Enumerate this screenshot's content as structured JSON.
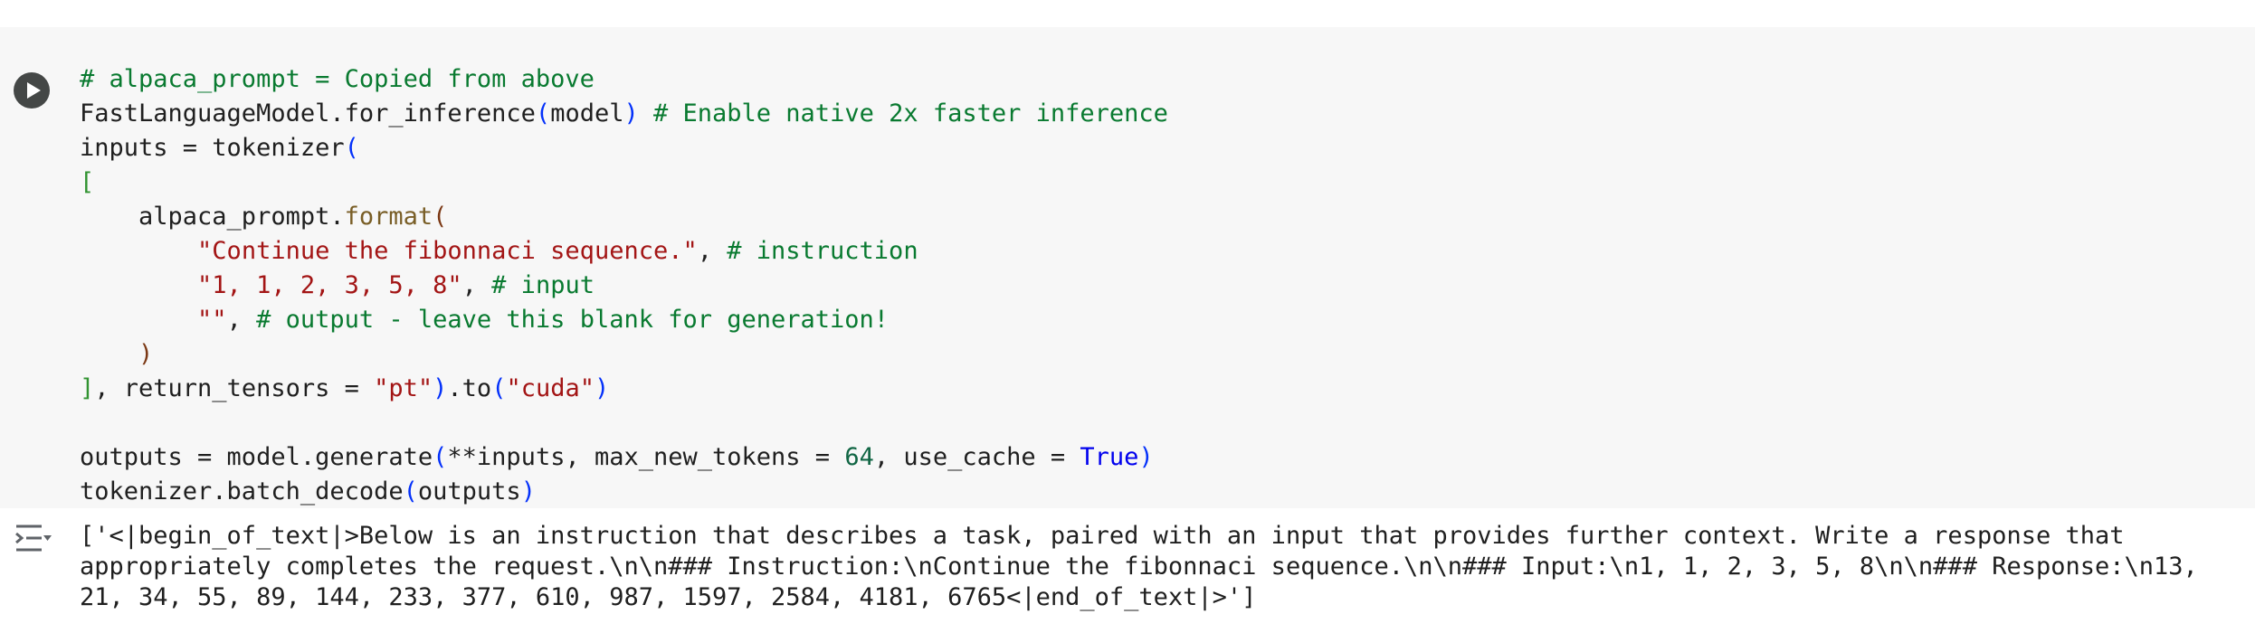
{
  "cell": {
    "run_button": "run-cell-button",
    "lines": [
      [
        {
          "t": "# alpaca_prompt = Copied from above",
          "c": "cmt"
        }
      ],
      [
        {
          "t": "FastLanguageModel.for_inference",
          "c": ""
        },
        {
          "t": "(",
          "c": "br"
        },
        {
          "t": "model",
          "c": ""
        },
        {
          "t": ")",
          "c": "br"
        },
        {
          "t": " ",
          "c": ""
        },
        {
          "t": "# Enable native 2x faster inference",
          "c": "cmt"
        }
      ],
      [
        {
          "t": "inputs = tokenizer",
          "c": ""
        },
        {
          "t": "(",
          "c": "br"
        }
      ],
      [
        {
          "t": "[",
          "c": "brg"
        }
      ],
      [
        {
          "t": "    alpaca_prompt.",
          "c": ""
        },
        {
          "t": "format",
          "c": "fn"
        },
        {
          "t": "(",
          "c": "brr"
        }
      ],
      [
        {
          "t": "        ",
          "c": ""
        },
        {
          "t": "\"Continue the fibonnaci sequence.\"",
          "c": "str"
        },
        {
          "t": ", ",
          "c": ""
        },
        {
          "t": "# instruction",
          "c": "cmt"
        }
      ],
      [
        {
          "t": "        ",
          "c": ""
        },
        {
          "t": "\"1, 1, 2, 3, 5, 8\"",
          "c": "str"
        },
        {
          "t": ", ",
          "c": ""
        },
        {
          "t": "# input",
          "c": "cmt"
        }
      ],
      [
        {
          "t": "        ",
          "c": ""
        },
        {
          "t": "\"\"",
          "c": "str"
        },
        {
          "t": ", ",
          "c": ""
        },
        {
          "t": "# output - leave this blank for generation!",
          "c": "cmt"
        }
      ],
      [
        {
          "t": "    ",
          "c": ""
        },
        {
          "t": ")",
          "c": "brr"
        }
      ],
      [
        {
          "t": "]",
          "c": "brg"
        },
        {
          "t": ", return_tensors = ",
          "c": ""
        },
        {
          "t": "\"pt\"",
          "c": "str"
        },
        {
          "t": ")",
          "c": "br"
        },
        {
          "t": ".to",
          "c": ""
        },
        {
          "t": "(",
          "c": "br"
        },
        {
          "t": "\"cuda\"",
          "c": "str"
        },
        {
          "t": ")",
          "c": "br"
        }
      ],
      [],
      [
        {
          "t": "outputs = model.generate",
          "c": ""
        },
        {
          "t": "(",
          "c": "br"
        },
        {
          "t": "**inputs, max_new_tokens = ",
          "c": ""
        },
        {
          "t": "64",
          "c": "num"
        },
        {
          "t": ", use_cache = ",
          "c": ""
        },
        {
          "t": "True",
          "c": "kw"
        },
        {
          "t": ")",
          "c": "br"
        }
      ],
      [
        {
          "t": "tokenizer.batch_decode",
          "c": ""
        },
        {
          "t": "(",
          "c": "br"
        },
        {
          "t": "outputs",
          "c": ""
        },
        {
          "t": ")",
          "c": "br"
        }
      ]
    ]
  },
  "output": {
    "icon": "output-toggle-icon",
    "text": "['<|begin_of_text|>Below is an instruction that describes a task, paired with an input that provides further context. Write a response that appropriately completes the request.\\n\\n### Instruction:\\nContinue the fibonnaci sequence.\\n\\n### Input:\\n1, 1, 2, 3, 5, 8\\n\\n### Response:\\n13, 21, 34, 55, 89, 144, 233, 377, 610, 987, 1597, 2584, 4181, 6765<|end_of_text|>']"
  },
  "colors": {
    "cell_bg": "#f7f7f7",
    "comment": "#097a30",
    "string": "#a31515",
    "number": "#116644",
    "keyword": "#0000ee"
  }
}
